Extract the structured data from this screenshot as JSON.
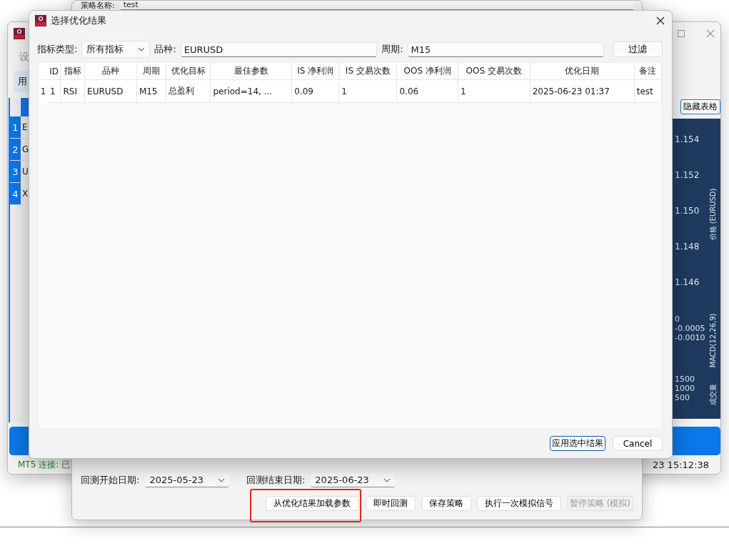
{
  "main_window": {
    "menu_item": "设",
    "tab": {
      "label": "用",
      "selected": true
    },
    "rows": [
      {
        "number": "1",
        "symbol": "E",
        "selected": true
      },
      {
        "number": "2",
        "symbol": "G",
        "selected": true
      },
      {
        "number": "3",
        "symbol": "U",
        "selected": true
      },
      {
        "number": "4",
        "symbol": "X",
        "selected": true
      }
    ],
    "hide_table_button": "隐藏表格",
    "chart": {
      "price_ticks": [
        "1.154",
        "1.152",
        "1.150",
        "1.148",
        "1.146"
      ],
      "price_title": "价格 (EURUSD)",
      "macd_title": "MACD(12,26,9)",
      "macd_ticks": [
        "0",
        "-0.0005",
        "-0.0010"
      ],
      "volume_title": "成交量",
      "volume_ticks": [
        "1500",
        "1000",
        "500"
      ]
    },
    "status": {
      "connection": "MT5 连接: 已",
      "time": "23 15:12:38"
    }
  },
  "strategy_window": {
    "name_label": "策略名称:",
    "name_value": "test",
    "start_label": "回测开始日期:",
    "start_value": "2025-05-23",
    "end_label": "回测结束日期:",
    "end_value": "2025-06-23",
    "buttons": [
      {
        "label": "从优化结果加载参数",
        "disabled": false,
        "highlighted": true
      },
      {
        "label": "即时回测",
        "disabled": false,
        "highlighted": false
      },
      {
        "label": "保存策略",
        "disabled": false,
        "highlighted": false
      },
      {
        "label": "执行一次模拟信号",
        "disabled": false,
        "highlighted": false
      },
      {
        "label": "暂停策略 (模拟)",
        "disabled": true,
        "highlighted": false
      }
    ]
  },
  "dialog": {
    "title": "选择优化结果",
    "filters": {
      "type_label": "指标类型:",
      "type_value": "所有指标",
      "symbol_label": "品种:",
      "symbol_value": "EURUSD",
      "period_label": "周期:",
      "period_value": "M15",
      "filter_button": "过滤"
    },
    "table": {
      "columns": [
        "ID",
        "指标",
        "品种",
        "周期",
        "优化目标",
        "最佳参数",
        "IS 净利润",
        "IS 交易次数",
        "OOS 净利润",
        "OOS 交易次数",
        "优化日期",
        "备注"
      ],
      "rows": [
        {
          "number": "1",
          "selected": false,
          "cells": [
            "1",
            "RSI",
            "EURUSD",
            "M15",
            "总盈利",
            "period=14, ...",
            "0.09",
            "1",
            "0.06",
            "1",
            "2025-06-23 01:37",
            "test"
          ]
        }
      ]
    },
    "buttons": [
      {
        "label": "应用选中结果",
        "focused": true
      },
      {
        "label": "Cancel",
        "focused": false
      }
    ]
  }
}
